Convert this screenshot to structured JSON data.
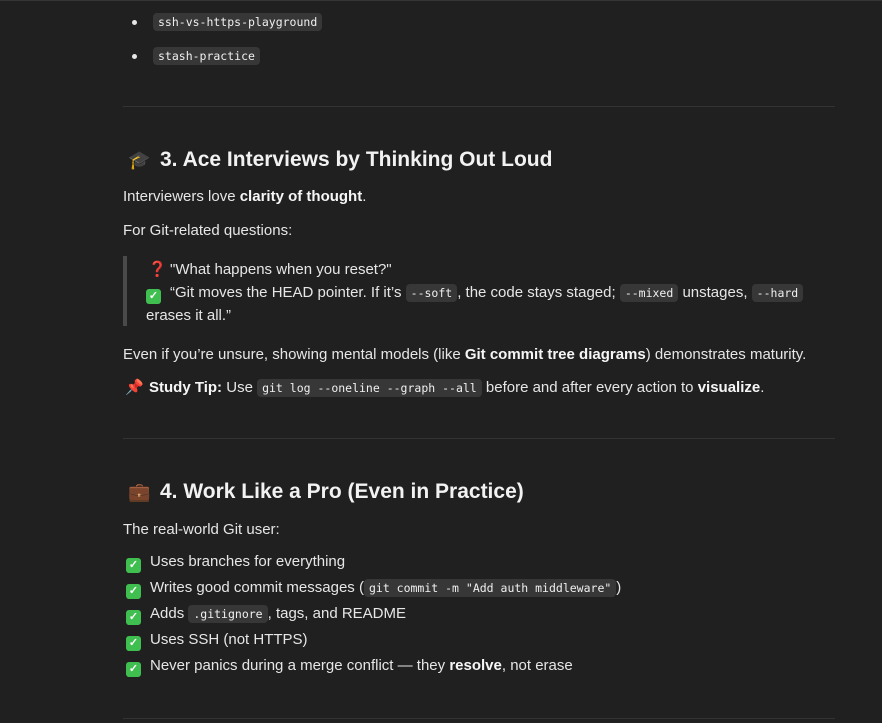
{
  "top_list": [
    "ssh-vs-https-playground",
    "stash-practice"
  ],
  "section3": {
    "emoji": "🎓",
    "heading": "3. Ace Interviews by Thinking Out Loud",
    "p1_pre": "Interviewers love ",
    "p1_bold": "clarity of thought",
    "p1_post": ".",
    "p2": "For Git-related questions:",
    "quote": {
      "q_icon": "❓",
      "q_text": "\"What happens when you reset?\"",
      "a_icon": "✓",
      "a_pre": "“Git moves the HEAD pointer. If it’s ",
      "code1": "--soft",
      "a_mid1": ", the code stays staged; ",
      "code2": "--mixed",
      "a_mid2": " unstages, ",
      "code3": "--hard",
      "a_end": "erases it all.”"
    },
    "p3_pre": "Even if you’re unsure, showing mental models (like ",
    "p3_bold": "Git commit tree diagrams",
    "p3_post": ") demonstrates maturity.",
    "tip_icon": "📌",
    "tip_label": "Study Tip:",
    "tip_pre": " Use ",
    "tip_code": "git log --oneline --graph --all",
    "tip_mid": " before and after every action to ",
    "tip_bold": "visualize",
    "tip_post": "."
  },
  "section4": {
    "emoji": "💼",
    "heading": "4. Work Like a Pro (Even in Practice)",
    "intro": "The real-world Git user:",
    "check_icon": "✓",
    "items": {
      "i1": "Uses branches for everything",
      "i2_pre": "Writes good commit messages (",
      "i2_code": "git commit -m \"Add auth middleware\"",
      "i2_post": ")",
      "i3_pre": "Adds ",
      "i3_code": ".gitignore",
      "i3_post": ", tags, and README",
      "i4": "Uses SSH (not HTTPS)",
      "i5_pre": "Never panics during a merge conflict — they ",
      "i5_bold": "resolve",
      "i5_post": ", not erase"
    }
  },
  "colors": {
    "background": "#202020",
    "text": "#e6e6e6",
    "code_bg": "#373737",
    "check": "#3fbf4f"
  }
}
